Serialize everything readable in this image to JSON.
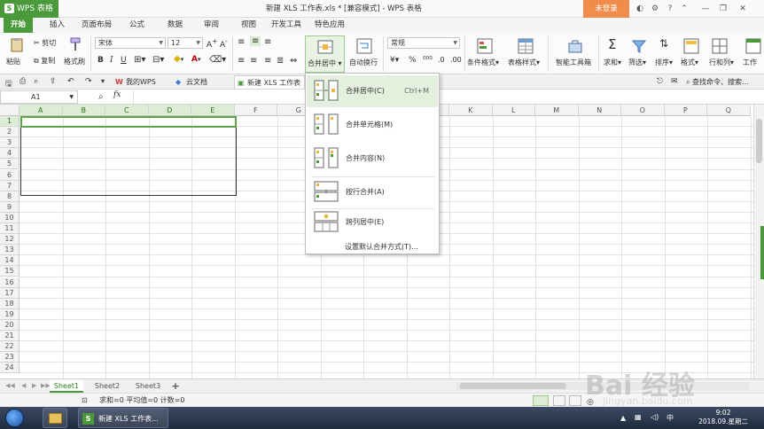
{
  "titlebar": {
    "app": "WPS 表格",
    "title": "新建 XLS 工作表.xls * [兼容模式] - WPS 表格",
    "login": "未登录"
  },
  "tabs": [
    "开始",
    "插入",
    "页面布局",
    "公式",
    "数据",
    "审阅",
    "视图",
    "开发工具",
    "特色应用"
  ],
  "ribbon": {
    "paste": "粘贴",
    "cut": "剪切",
    "copy": "复制",
    "format_painter": "格式刷",
    "font": "宋体",
    "size": "12",
    "merge_center": "合并居中",
    "wrap": "自动换行",
    "number_format": "常规",
    "percent": "%",
    "cond_format": "条件格式",
    "table_style": "表格样式",
    "smart_toolbox": "智能工具箱",
    "sum": "求和",
    "filter": "筛选",
    "sort": "排序",
    "format": "格式",
    "row_col": "行和列",
    "worksheet": "工作"
  },
  "doc_tabs": [
    {
      "label": "我的WPS"
    },
    {
      "label": "云文档"
    },
    {
      "label": "新建 XLS 工作表"
    }
  ],
  "search_placeholder": "查找命令、搜索...",
  "formula": {
    "cell": "A1",
    "fx": "fx"
  },
  "columns": [
    "A",
    "B",
    "C",
    "D",
    "E",
    "F",
    "G",
    "H",
    "I",
    "J",
    "K",
    "L",
    "M",
    "N",
    "O",
    "P",
    "Q"
  ],
  "rows": [
    "1",
    "2",
    "3",
    "4",
    "5",
    "6",
    "7",
    "8",
    "9",
    "10",
    "11",
    "12",
    "13",
    "14",
    "15",
    "16",
    "17",
    "18",
    "19",
    "20",
    "21",
    "22",
    "23",
    "24"
  ],
  "menu": {
    "items": [
      {
        "label": "合并居中(C)",
        "key": "Ctrl+M"
      },
      {
        "label": "合并单元格(M)",
        "key": ""
      },
      {
        "label": "合并内容(N)",
        "key": ""
      },
      {
        "label": "按行合并(A)",
        "key": ""
      },
      {
        "label": "跨列居中(E)",
        "key": ""
      }
    ],
    "default": "设置默认合并方式(T)..."
  },
  "sheets": [
    "Sheet1",
    "Sheet2",
    "Sheet3"
  ],
  "add_sheet": "+",
  "status": {
    "text": "求和=0  平均值=0  计数=0"
  },
  "taskbar": {
    "task": "新建 XLS 工作表...",
    "time": "9:02",
    "date": "2018.09.星期二"
  },
  "watermark": {
    "text": "Bai 经验",
    "url": "jingyan.baidu.com"
  },
  "colors": {
    "accent": "#4a9a3c",
    "login": "#f08c4b",
    "selection": "#5aa547"
  }
}
